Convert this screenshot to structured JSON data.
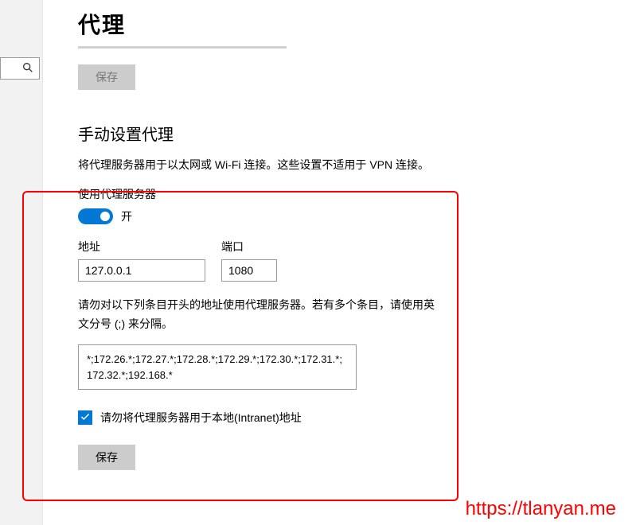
{
  "page_title": "代理",
  "save_top": "保存",
  "section_title": "手动设置代理",
  "description": "将代理服务器用于以太网或 Wi-Fi 连接。这些设置不适用于 VPN 连接。",
  "use_proxy_label": "使用代理服务器",
  "toggle_state": "开",
  "address_label": "地址",
  "address_value": "127.0.0.1",
  "port_label": "端口",
  "port_value": "1080",
  "bypass_help": "请勿对以下列条目开头的地址使用代理服务器。若有多个条目，请使用英文分号 (;) 来分隔。",
  "bypass_value": "*;172.26.*;172.27.*;172.28.*;172.29.*;172.30.*;172.31.*;172.32.*;192.168.*",
  "local_bypass_label": "请勿将代理服务器用于本地(Intranet)地址",
  "save_bottom": "保存",
  "watermark": "https://tlanyan.me"
}
